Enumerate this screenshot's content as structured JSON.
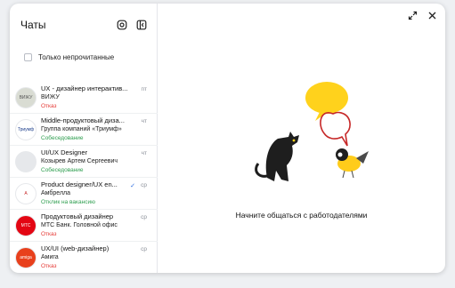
{
  "header": {
    "title": "Чаты"
  },
  "filter": {
    "label": "Только непрочитанные"
  },
  "chats": [
    {
      "position": "UX - дизайнер интерактив...",
      "company": "ВИЖУ",
      "status": "Отказ",
      "status_color": "#e53935",
      "date": "пт",
      "logo_text": "ВИЖУ",
      "logo_bg": "#d9dcd3",
      "logo_fg": "#555"
    },
    {
      "position": "Middle-продуктовый диза...",
      "company": "Группа компаний «Триумф»",
      "status": "Собеседование",
      "status_color": "#2e9e4f",
      "date": "чт",
      "logo_text": "Триумф",
      "logo_bg": "#ffffff",
      "logo_fg": "#1d3f8c"
    },
    {
      "position": "UI/UX Designer",
      "company": "Козырев Артем Сергеевич",
      "status": "Собеседование",
      "status_color": "#2e9e4f",
      "date": "чт",
      "logo_text": "",
      "logo_bg": "#e6e8eb",
      "logo_fg": "#999"
    },
    {
      "position": "Product designer/UX en...",
      "company": "Амбрелла",
      "status": "Отклик на вакансию",
      "status_color": "#2e9e4f",
      "date": "ср",
      "check": "✓",
      "logo_text": "A",
      "logo_bg": "#ffffff",
      "logo_fg": "#c62828"
    },
    {
      "position": "Продуктовый дизайнер",
      "company": "МТС Банк. Головной офис",
      "status": "Отказ",
      "status_color": "#e53935",
      "date": "ср",
      "logo_text": "МТС",
      "logo_bg": "#e30613",
      "logo_fg": "#ffffff"
    },
    {
      "position": "UX/UI (web-дизайнер)",
      "company": "Амига",
      "status": "Отказ",
      "status_color": "#e53935",
      "date": "ср",
      "logo_text": "amiga",
      "logo_bg": "#e8401c",
      "logo_fg": "#ffffff"
    }
  ],
  "empty_state": {
    "text": "Начните общаться с работодателями"
  }
}
